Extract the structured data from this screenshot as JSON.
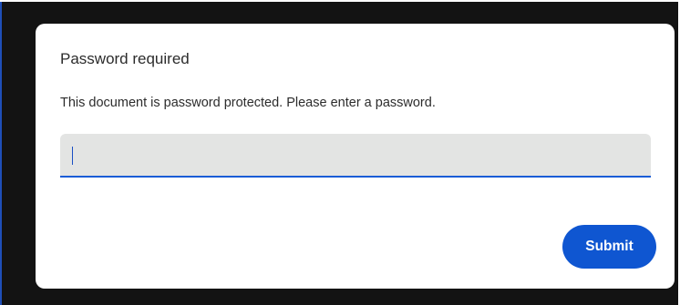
{
  "dialog": {
    "title": "Password required",
    "message": "This document is password protected. Please enter a password.",
    "password_value": "",
    "password_placeholder": "",
    "submit_label": "Submit"
  },
  "colors": {
    "backdrop": "#131313",
    "dialog_bg": "#ffffff",
    "field_bg": "#e3e4e3",
    "field_underline": "#1a5cd6",
    "accent": "#0f56d1",
    "text": "#2c2c2c"
  }
}
